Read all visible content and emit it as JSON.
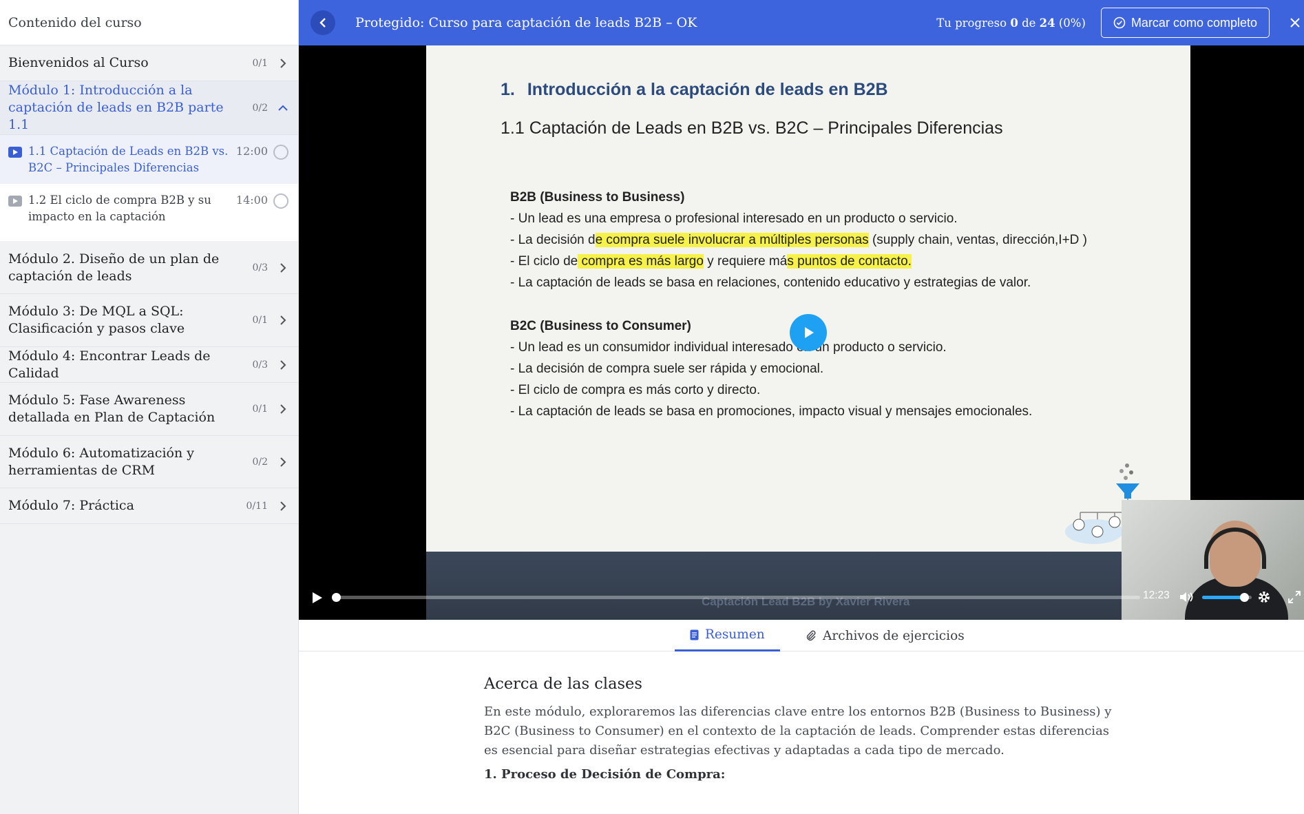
{
  "sidebar": {
    "header": "Contenido del curso",
    "sections": [
      {
        "title": "Bienvenidos al Curso",
        "count": "0/1"
      },
      {
        "title": "Módulo 1: Introducción a la captación de leads en B2B parte 1.1",
        "count": "0/2"
      },
      {
        "title": "Módulo 2. Diseño de un plan de captación de leads",
        "count": "0/3"
      },
      {
        "title": "Módulo 3: De MQL a SQL: Clasificación y pasos clave",
        "count": "0/1"
      },
      {
        "title": "Módulo 4: Encontrar Leads de Calidad",
        "count": "0/3"
      },
      {
        "title": "Módulo 5: Fase Awareness detallada en Plan de Captación",
        "count": "0/1"
      },
      {
        "title": "Módulo 6: Automatización y herramientas de CRM",
        "count": "0/2"
      },
      {
        "title": "Módulo 7: Práctica",
        "count": "0/11"
      }
    ],
    "lessons": [
      {
        "title": "1.1 Captación de Leads en B2B vs. B2C – Principales Diferencias",
        "duration": "12:00"
      },
      {
        "title": "1.2 El ciclo de compra B2B y su impacto en la captación",
        "duration": "14:00"
      }
    ]
  },
  "topbar": {
    "course_title": "Protegido: Curso para captación de leads B2B – OK",
    "progress_prefix": "Tu progreso",
    "progress_done": "0",
    "progress_of": "de",
    "progress_total": "24",
    "progress_pct": "(0%)",
    "complete_label": "Marcar como completo"
  },
  "slide": {
    "h1_num": "1.",
    "h1": "Introducción a la captación de leads en B2B",
    "h2": "1.1 Captación de Leads en B2B vs. B2C – Principales Diferencias",
    "b2b_head": "B2B (Business to Business)",
    "b2b_1": "- Un lead es una empresa o profesional interesado en un producto o servicio.",
    "b2b_2a": "- La decisión d",
    "b2b_2h": "e compra suele involucrar a múltiples personas",
    "b2b_2b": " (supply chain, ventas, dirección,I+D )",
    "b2b_3a": "- El ciclo de",
    "b2b_3h1": " compra es más largo",
    "b2b_3b": " y requiere má",
    "b2b_3h2": "s puntos de contacto.",
    "b2b_4": "- La captación de leads se basa en relaciones, contenido educativo y estrategias de valor.",
    "b2c_head": "B2C (Business to Consumer)",
    "b2c_1": "- Un lead es un consumidor individual interesado en un producto o servicio.",
    "b2c_2": "- La decisión de compra suele ser rápida y emocional.",
    "b2c_3": "- El ciclo de compra es más corto y directo.",
    "b2c_4": "- La captación de leads se basa en promociones, impacto visual y mensajes emocionales.",
    "watermark": "Captación Lead B2B by Xavier Rivera"
  },
  "player": {
    "time": "12:23",
    "seek_progress": 0.0,
    "volume": 0.85
  },
  "tabs": {
    "summary": "Resumen",
    "files": "Archivos de ejercicios"
  },
  "content": {
    "heading": "Acerca de las clases",
    "paragraph": "En este módulo, exploraremos las diferencias clave entre los entornos B2B (Business to Business) y B2C (Business to Consumer) en el contexto de la captación de leads. Comprender estas diferencias es esencial para diseñar estrategias efectivas y adaptadas a cada tipo de mercado.",
    "subheading": "1. Proceso de Decisión de Compra:"
  },
  "colors": {
    "brand": "#3d63dd",
    "accent_text": "#3a5ed6",
    "player_accent": "#1ea1f2",
    "highlight": "#f6f24a"
  }
}
